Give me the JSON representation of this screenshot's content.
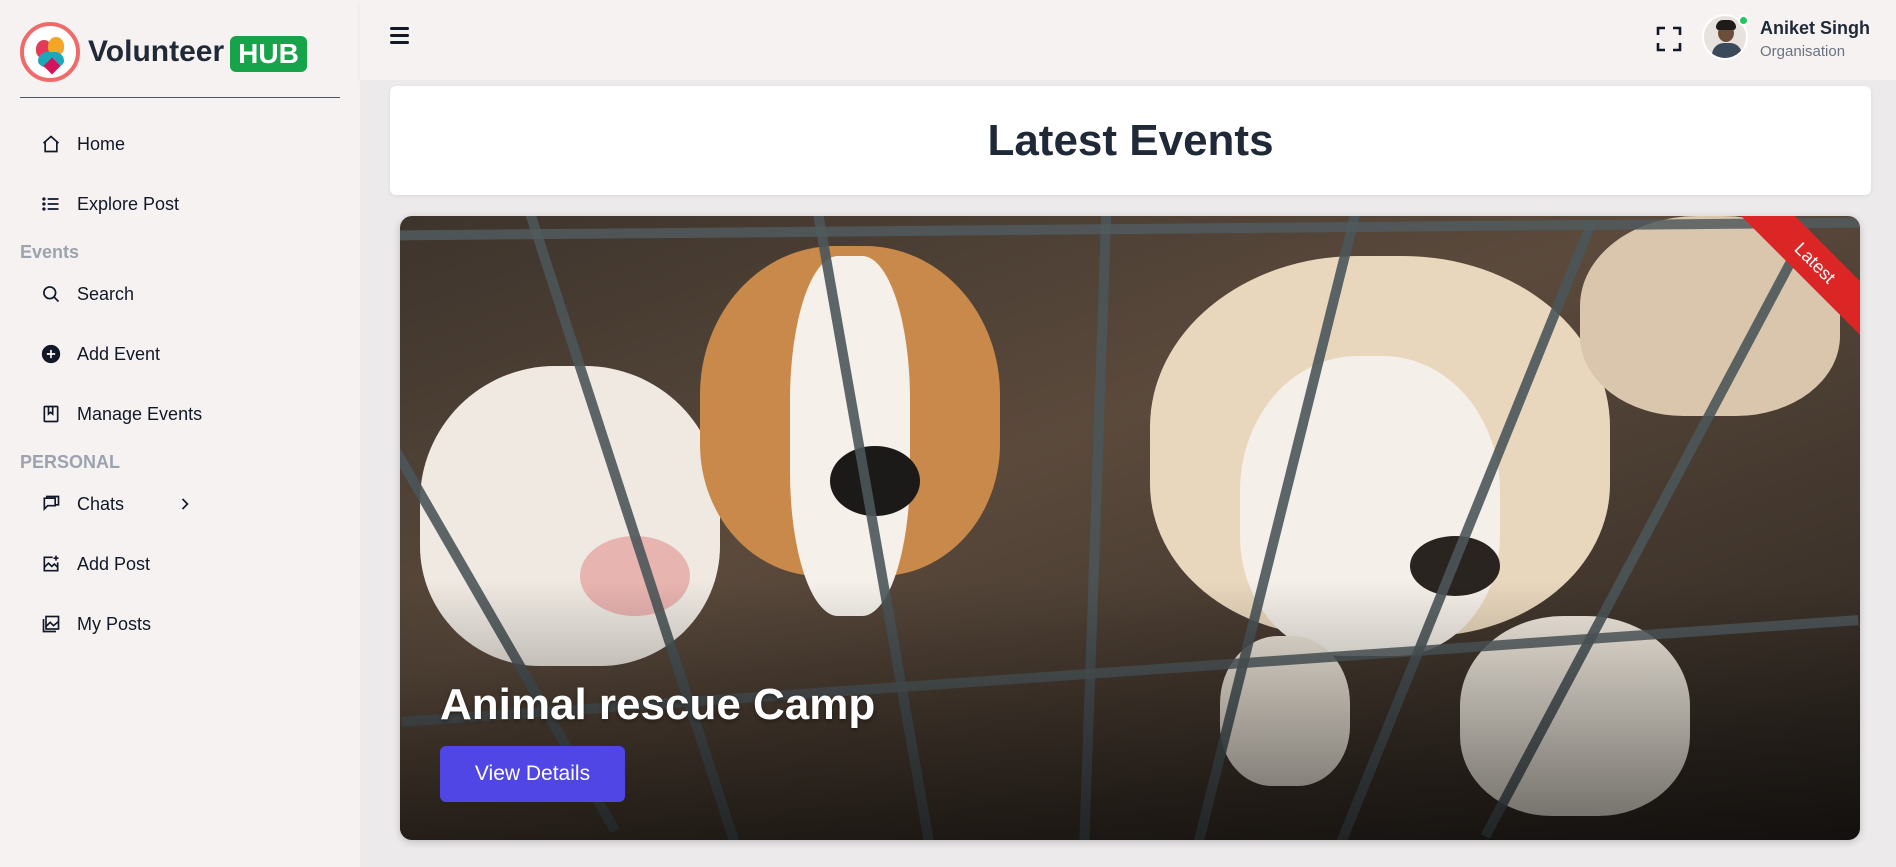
{
  "brand": {
    "name": "Volunteer",
    "badge": "HUB"
  },
  "sidebar": {
    "items": [
      {
        "label": "Home",
        "icon": "home-icon"
      },
      {
        "label": "Explore Post",
        "icon": "list-icon"
      }
    ],
    "events_section": "Events",
    "events_items": [
      {
        "label": "Search",
        "icon": "search-icon"
      },
      {
        "label": "Add Event",
        "icon": "plus-circle-icon"
      },
      {
        "label": "Manage Events",
        "icon": "book-icon"
      }
    ],
    "personal_section": "PERSONAL",
    "personal_items": [
      {
        "label": "Chats",
        "icon": "chat-icon"
      },
      {
        "label": "Add Post",
        "icon": "image-plus-icon"
      },
      {
        "label": "My Posts",
        "icon": "images-icon"
      }
    ]
  },
  "topbar": {
    "user_name": "Aniket Singh",
    "user_role": "Organisation"
  },
  "main": {
    "title": "Latest Events",
    "event": {
      "title": "Animal rescue Camp",
      "ribbon": "Latest",
      "button": "View Details"
    }
  },
  "colors": {
    "accent": "#4f46e5",
    "hub_badge": "#16a34a",
    "ribbon": "#dc2626",
    "online": "#22c55e"
  }
}
